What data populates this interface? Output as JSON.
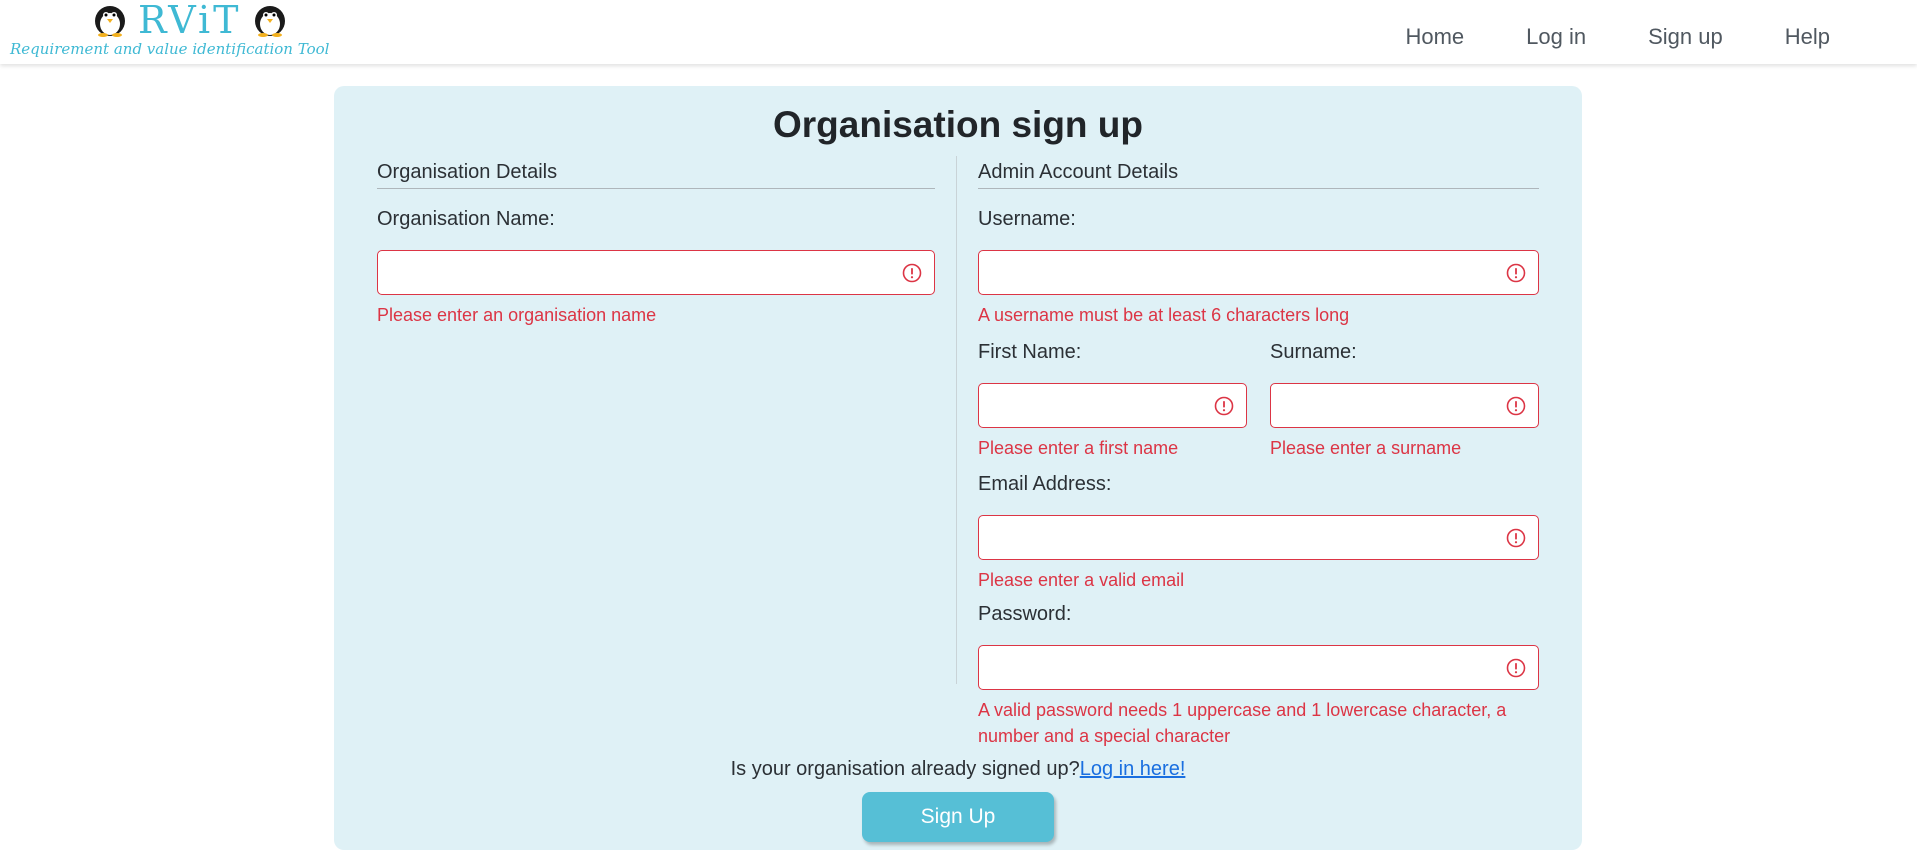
{
  "logo": {
    "title": "RViT",
    "subtitle": "Requirement and value identification Tool",
    "color": "#3fb9d4"
  },
  "nav": {
    "items": [
      {
        "label": "Home"
      },
      {
        "label": "Log in"
      },
      {
        "label": "Sign up"
      },
      {
        "label": "Help"
      }
    ]
  },
  "form": {
    "title": "Organisation sign up",
    "organisation_section": {
      "title": "Organisation Details",
      "org_name": {
        "label": "Organisation Name:",
        "value": "",
        "error": "Please enter an organisation name"
      }
    },
    "admin_section": {
      "title": "Admin Account Details",
      "username": {
        "label": "Username:",
        "value": "",
        "error": "A username must be at least 6 characters long"
      },
      "first_name": {
        "label": "First Name:",
        "value": "",
        "error": "Please enter a first name"
      },
      "surname": {
        "label": "Surname:",
        "value": "",
        "error": "Please enter a surname"
      },
      "email": {
        "label": "Email Address:",
        "value": "",
        "error": "Please enter a valid email"
      },
      "password": {
        "label": "Password:",
        "value": "",
        "error": "A valid password needs 1 uppercase and 1 lowercase character, a number and a special character"
      }
    },
    "already_text": "Is your organisation already signed up?",
    "login_link": "Log in here!",
    "submit_label": "Sign Up"
  },
  "colors": {
    "card_background": "#dff1f6",
    "error": "#dc3545",
    "button": "#56bfd6",
    "link": "#1a6fe0"
  },
  "icons": {
    "error": "exclamation-circle-icon",
    "logo": "penguin-icon"
  }
}
